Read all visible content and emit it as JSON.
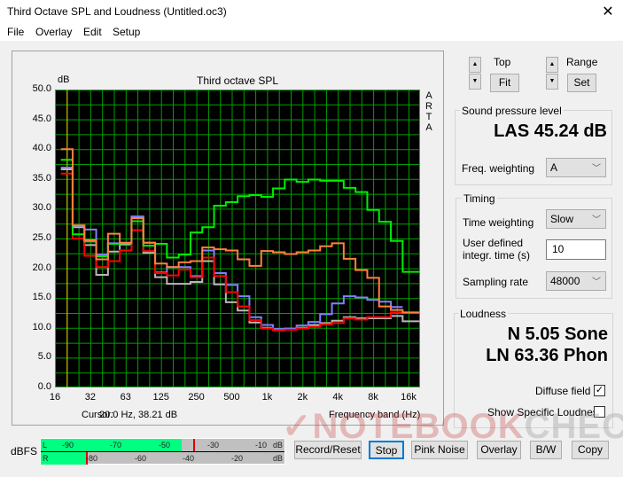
{
  "window": {
    "title": "Third Octave SPL and Loudness (Untitled.oc3)",
    "close_icon": "close-icon"
  },
  "menu": [
    "File",
    "Overlay",
    "Edit",
    "Setup"
  ],
  "chart": {
    "ylabel": "dB",
    "title": "Third octave SPL",
    "brand": "ARTA",
    "xlabel": "Frequency band (Hz)",
    "cursor_label": "Cursor:",
    "cursor_value": "20.0 Hz, 38.21 dB"
  },
  "chart_data": {
    "type": "line",
    "step": true,
    "title": "Third octave SPL",
    "ylabel": "dB",
    "xlabel": "Frequency band (Hz)",
    "ylim": [
      0,
      50
    ],
    "grid": true,
    "background": "#000000",
    "grid_color": "#00a000",
    "yticks": [
      "0.0",
      "5.0",
      "10.0",
      "15.0",
      "20.0",
      "25.0",
      "30.0",
      "35.0",
      "40.0",
      "45.0",
      "50.0"
    ],
    "xticks": [
      "16",
      "32",
      "63",
      "125",
      "250",
      "500",
      "1k",
      "2k",
      "4k",
      "8k",
      "16k"
    ],
    "x": [
      "20",
      "25",
      "31.5",
      "40",
      "50",
      "63",
      "80",
      "100",
      "125",
      "160",
      "200",
      "250",
      "315",
      "400",
      "500",
      "630",
      "800",
      "1k",
      "1.25k",
      "1.6k",
      "2k",
      "2.5k",
      "3.15k",
      "4k",
      "5k",
      "6.3k",
      "8k",
      "10k",
      "12.5k",
      "16k",
      "20k"
    ],
    "cursor_x": "20",
    "series": [
      {
        "color": "#b8b8b8",
        "values": [
          36.6,
          26.9,
          23.9,
          18.9,
          22.8,
          24.0,
          28.5,
          22.6,
          18.5,
          17.4,
          17.4,
          17.7,
          21.2,
          17.3,
          14.3,
          12.9,
          10.9,
          10.0,
          9.7,
          9.8,
          10.0,
          10.5,
          10.8,
          11.2,
          11.8,
          11.6,
          11.6,
          11.6,
          12.0,
          11.1,
          11.1
        ]
      },
      {
        "color": "#8080ff",
        "values": [
          36.9,
          27.1,
          26.5,
          22.3,
          24.2,
          24.2,
          28.7,
          24.3,
          19.3,
          20.2,
          20.2,
          18.7,
          23.0,
          19.2,
          17.2,
          15.3,
          11.8,
          10.5,
          9.8,
          9.9,
          10.4,
          11.0,
          12.3,
          14.1,
          15.3,
          15.1,
          14.7,
          14.4,
          13.5,
          null,
          null
        ]
      },
      {
        "color": "#ff0000",
        "values": [
          35.9,
          25.0,
          22.1,
          20.2,
          21.2,
          23.0,
          26.4,
          22.9,
          19.2,
          18.8,
          19.8,
          18.5,
          21.8,
          18.7,
          16.0,
          13.6,
          11.3,
          9.9,
          9.6,
          9.7,
          9.9,
          10.2,
          10.6,
          10.8,
          11.6,
          11.4,
          11.8,
          11.8,
          12.6,
          12.6,
          null
        ]
      },
      {
        "color": "#00ee00",
        "values": [
          38.2,
          25.7,
          24.5,
          22.0,
          24.1,
          24.2,
          27.9,
          23.8,
          24.1,
          21.8,
          22.3,
          26.0,
          26.9,
          30.5,
          31.1,
          32.1,
          32.3,
          32.0,
          33.4,
          34.9,
          34.5,
          34.9,
          34.7,
          34.7,
          33.5,
          32.8,
          29.8,
          27.8,
          24.6,
          19.4,
          19.4
        ]
      },
      {
        "color": "#ff8040",
        "values": [
          40.0,
          27.2,
          24.7,
          21.5,
          25.8,
          24.3,
          28.4,
          24.3,
          20.8,
          20.2,
          21.0,
          21.2,
          23.5,
          23.2,
          23.0,
          21.5,
          20.4,
          22.9,
          22.7,
          22.4,
          22.7,
          23.0,
          23.7,
          24.2,
          21.6,
          19.7,
          18.4,
          13.6,
          13.0,
          12.6,
          12.6
        ]
      }
    ]
  },
  "scale": {
    "top_label": "Top",
    "fit": "Fit",
    "range_label": "Range",
    "set": "Set",
    "up_icon": "arrow-up-icon",
    "down_icon": "arrow-down-icon"
  },
  "spl": {
    "title": "Sound pressure level",
    "value": "LAS 45.24 dB",
    "freq_label": "Freq. weighting",
    "freq_value": "A"
  },
  "timing": {
    "title": "Timing",
    "tw_label": "Time weighting",
    "tw_value": "Slow",
    "it_label1": "User defined",
    "it_label2": "integr. time (s)",
    "it_value": "10",
    "sr_label": "Sampling rate",
    "sr_value": "48000"
  },
  "loudness": {
    "title": "Loudness",
    "n": "N 5.05 Sone",
    "ln": "LN 63.36 Phon",
    "diffuse": "Diffuse field",
    "diffuse_checked": true,
    "specific": "Show Specific Loudness",
    "specific_checked": false
  },
  "meter": {
    "label": "dBFS",
    "l": "L",
    "r": "R",
    "l_ticks": [
      "-90",
      "-70",
      "-50",
      "-30",
      "-10",
      "dB"
    ],
    "r_ticks": [
      "-80",
      "-60",
      "-40",
      "-20",
      "dB"
    ],
    "l_level_dbfs": -43,
    "l_peak_dbfs": -38,
    "r_level_dbfs": -83,
    "r_peak_dbfs": -83,
    "fill_color": "#00ff80"
  },
  "buttons": {
    "record": "Record/Reset",
    "stop": "Stop",
    "pink": "Pink Noise",
    "overlay": "Overlay",
    "bw": "B/W",
    "copy": "Copy"
  },
  "watermark": "NOTEBOOKCHECK"
}
